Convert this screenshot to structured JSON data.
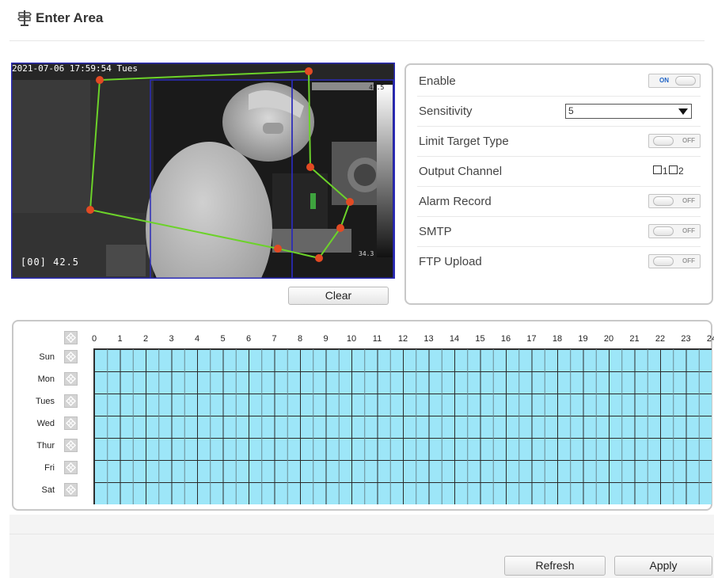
{
  "page": {
    "title": "Enter Area",
    "icon": "signpost-icon"
  },
  "video": {
    "timestamp": "2021-07-06 17:59:54 Tues",
    "camera_id": "[00] 42.5",
    "temp_max": "42.5",
    "temp_min": "34.3"
  },
  "clear_label": "Clear",
  "settings": {
    "enable": {
      "label": "Enable",
      "state": "ON"
    },
    "sensitivity": {
      "label": "Sensitivity",
      "value": "5"
    },
    "limit_target_type": {
      "label": "Limit Target Type",
      "state": "OFF"
    },
    "output_channel": {
      "label": "Output Channel",
      "channels": [
        "1",
        "2"
      ]
    },
    "alarm_record": {
      "label": "Alarm Record",
      "state": "OFF"
    },
    "smtp": {
      "label": "SMTP",
      "state": "OFF"
    },
    "ftp_upload": {
      "label": "FTP Upload",
      "state": "OFF"
    }
  },
  "schedule": {
    "hours": [
      "0",
      "1",
      "2",
      "3",
      "4",
      "5",
      "6",
      "7",
      "8",
      "9",
      "10",
      "11",
      "12",
      "13",
      "14",
      "15",
      "16",
      "17",
      "18",
      "19",
      "20",
      "21",
      "22",
      "23",
      "24"
    ],
    "days": [
      "Sun",
      "Mon",
      "Tues",
      "Wed",
      "Thur",
      "Fri",
      "Sat"
    ],
    "fill_color": "#9de6f8"
  },
  "footer": {
    "refresh_label": "Refresh",
    "apply_label": "Apply"
  }
}
